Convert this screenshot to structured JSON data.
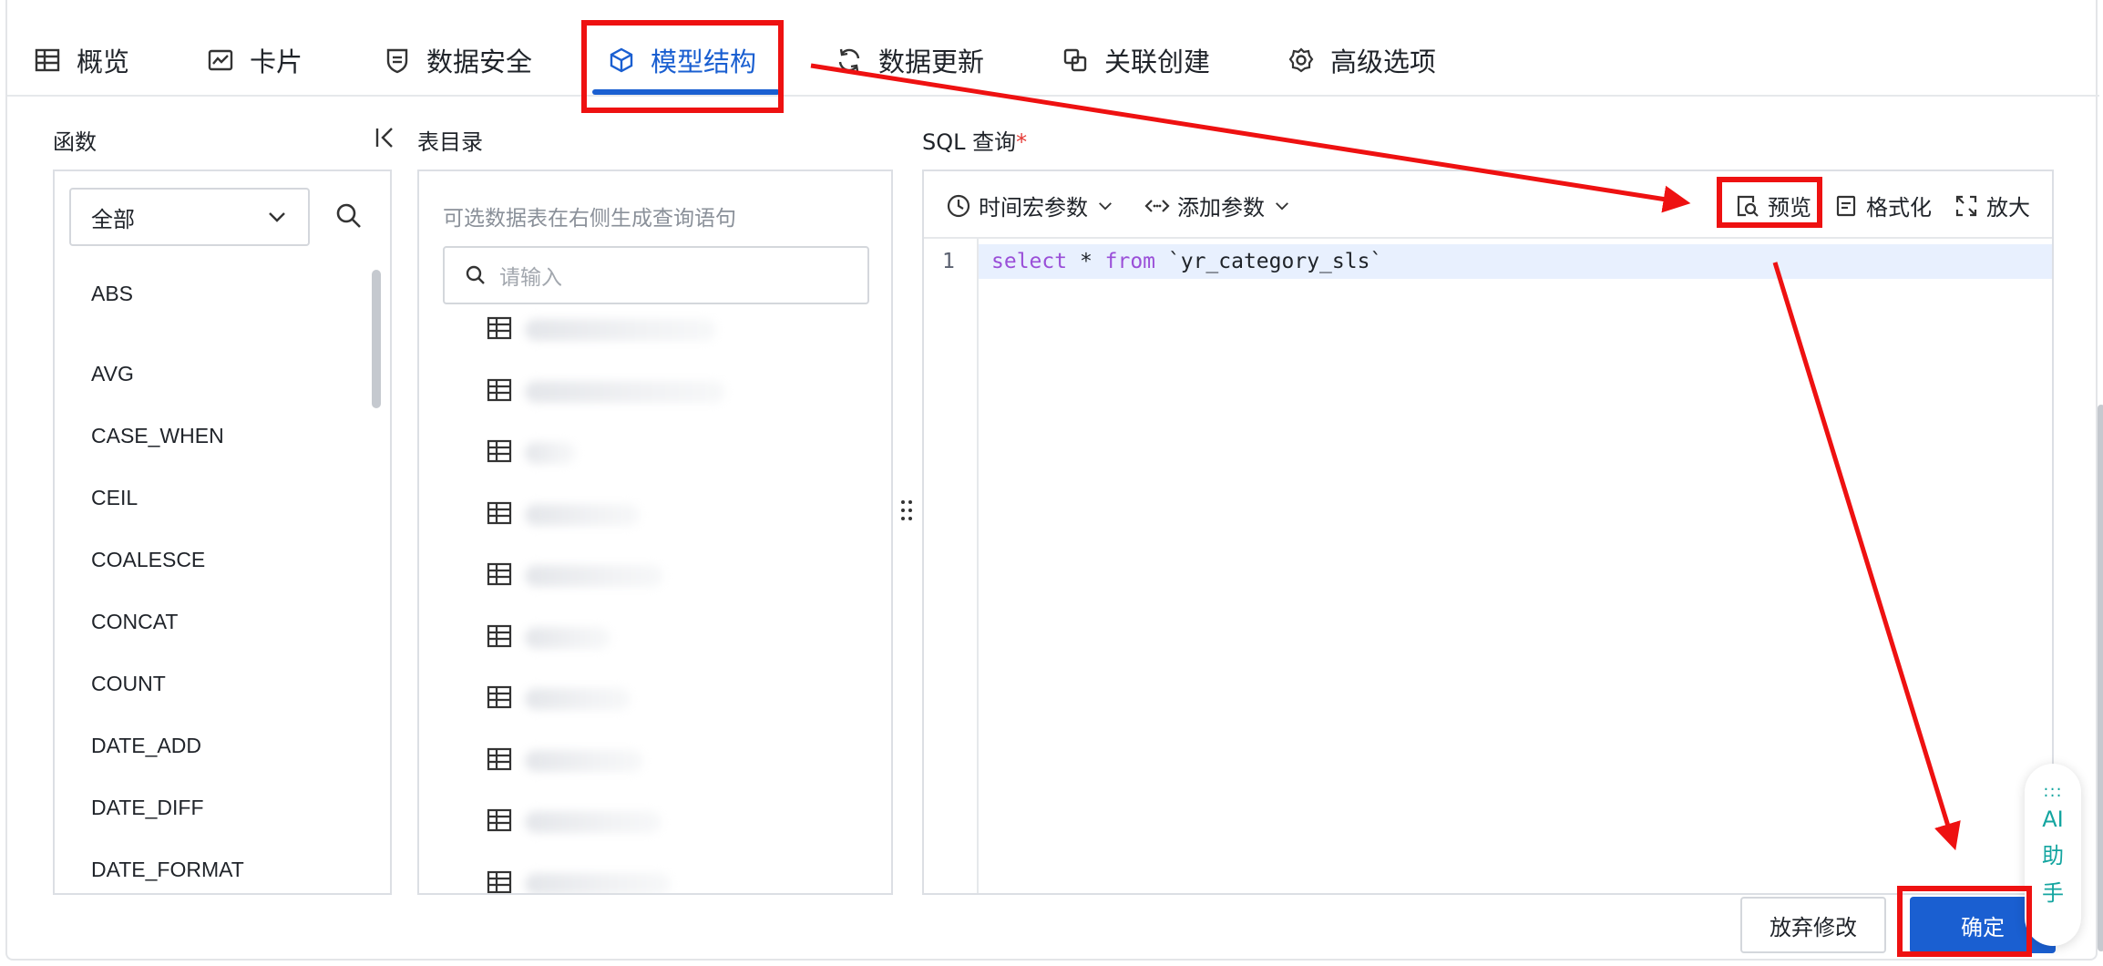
{
  "tabs": [
    {
      "label": "概览",
      "icon": "table-icon"
    },
    {
      "label": "卡片",
      "icon": "chart-line-icon"
    },
    {
      "label": "数据安全",
      "icon": "shield-icon"
    },
    {
      "label": "模型结构",
      "icon": "cube-icon",
      "active": true
    },
    {
      "label": "数据更新",
      "icon": "refresh-icon"
    },
    {
      "label": "关联创建",
      "icon": "link-create-icon"
    },
    {
      "label": "高级选项",
      "icon": "gear-icon"
    }
  ],
  "functions": {
    "label": "函数",
    "filter_value": "全部",
    "items": [
      "ABS",
      "AVG",
      "CASE_WHEN",
      "CEIL",
      "COALESCE",
      "CONCAT",
      "COUNT",
      "DATE_ADD",
      "DATE_DIFF",
      "DATE_FORMAT"
    ]
  },
  "tables": {
    "label": "表目录",
    "hint": "可选数据表在右侧生成查询语句",
    "search_placeholder": "请输入",
    "row_count": 10
  },
  "sql": {
    "label": "SQL 查询",
    "required_mark": "*",
    "toolbar": {
      "time_macro": "时间宏参数",
      "add_param": "添加参数",
      "preview": "预览",
      "format": "格式化",
      "zoom": "放大"
    },
    "line_number": "1",
    "code": {
      "kw1": "select",
      "mid": " * ",
      "kw2": "from",
      "rest": " `yr_category_sls`"
    }
  },
  "buttons": {
    "cancel": "放弃修改",
    "ok": "确定"
  },
  "ai_helper": {
    "dots": ":::",
    "line1": "AI",
    "line2": "助",
    "line3": "手"
  },
  "colors": {
    "accent": "#1a5fd1",
    "annotation": "#ee1111",
    "ai": "#14a5a0"
  }
}
